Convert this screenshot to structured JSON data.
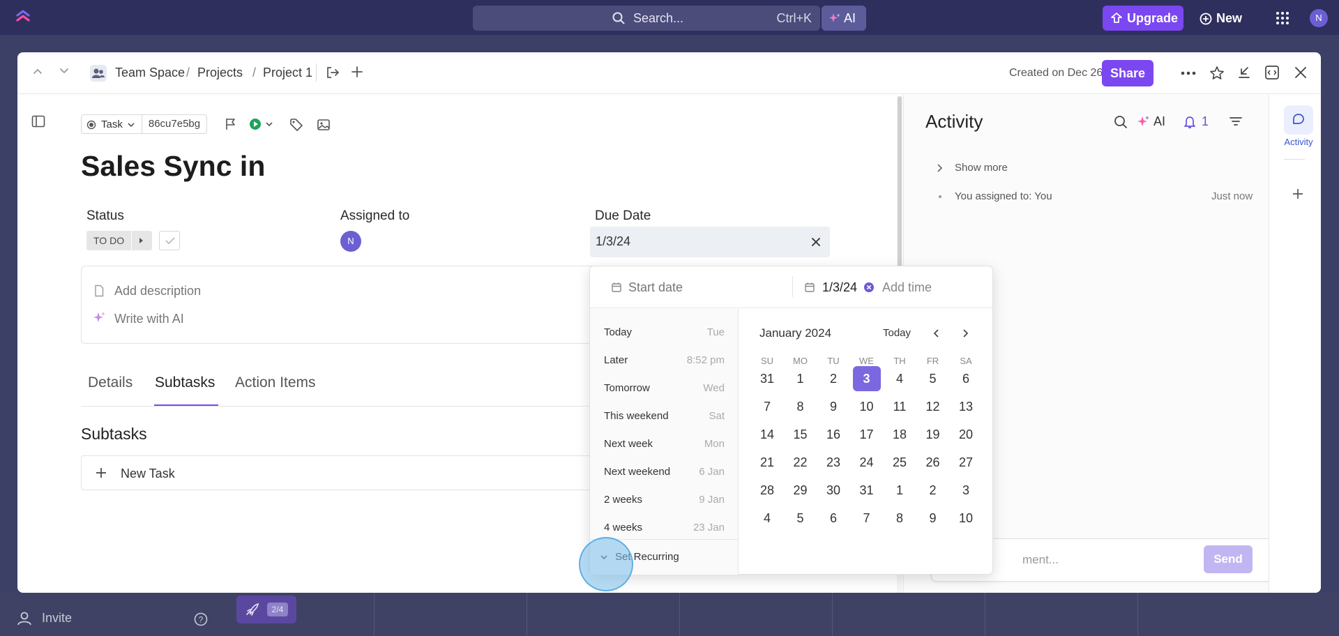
{
  "topbar": {
    "search_placeholder": "Search...",
    "search_shortcut": "Ctrl+K",
    "ai_label": "AI",
    "upgrade_label": "Upgrade",
    "new_label": "New",
    "avatar_initial": "N"
  },
  "background": {
    "invite_label": "Invite",
    "progress_badge": "2/4"
  },
  "modal": {
    "breadcrumb": [
      "Team Space",
      "Projects",
      "Project 1"
    ],
    "breadcrumb_sep": "/",
    "created_text": "Created on Dec 26",
    "share_label": "Share",
    "task_type": "Task",
    "task_id": "86cu7e5bg",
    "title": "Sales Sync in",
    "status_label": "Status",
    "status_value": "TO DO",
    "assigned_label": "Assigned to",
    "assignee_initial": "N",
    "due_label": "Due Date",
    "due_value": "1/3/24",
    "add_description": "Add description",
    "write_ai": "Write with AI",
    "tabs": [
      "Details",
      "Subtasks",
      "Action Items"
    ],
    "active_tab": "Subtasks",
    "subtasks_heading": "Subtasks",
    "new_task_label": "New Task"
  },
  "activity": {
    "title": "Activity",
    "ai_label": "AI",
    "notif_count": "1",
    "show_more": "Show more",
    "entry_text": "You assigned to: You",
    "entry_time": "Just now",
    "comment_placeholder": "ment...",
    "send_label": "Send",
    "rail_label": "Activity"
  },
  "datepicker": {
    "start_placeholder": "Start date",
    "due_value": "1/3/24",
    "add_time": "Add time",
    "quick_options": [
      {
        "label": "Today",
        "value": "Tue"
      },
      {
        "label": "Later",
        "value": "8:52 pm"
      },
      {
        "label": "Tomorrow",
        "value": "Wed"
      },
      {
        "label": "This weekend",
        "value": "Sat"
      },
      {
        "label": "Next week",
        "value": "Mon"
      },
      {
        "label": "Next weekend",
        "value": "6 Jan"
      },
      {
        "label": "2 weeks",
        "value": "9 Jan"
      },
      {
        "label": "4 weeks",
        "value": "23 Jan"
      }
    ],
    "set_recurring": "Set Recurring",
    "month_label": "January 2024",
    "today_label": "Today",
    "weekdays": [
      "SU",
      "MO",
      "TU",
      "WE",
      "TH",
      "FR",
      "SA"
    ],
    "weeks": [
      [
        "31",
        "1",
        "2",
        "3",
        "4",
        "5",
        "6"
      ],
      [
        "7",
        "8",
        "9",
        "10",
        "11",
        "12",
        "13"
      ],
      [
        "14",
        "15",
        "16",
        "17",
        "18",
        "19",
        "20"
      ],
      [
        "21",
        "22",
        "23",
        "24",
        "25",
        "26",
        "27"
      ],
      [
        "28",
        "29",
        "30",
        "31",
        "1",
        "2",
        "3"
      ],
      [
        "4",
        "5",
        "6",
        "7",
        "8",
        "9",
        "10"
      ]
    ],
    "selected_day": "3"
  },
  "colors": {
    "accent": "#7b47f0",
    "topbar": "#2f2f5e",
    "selected_day": "#7b68e0"
  }
}
